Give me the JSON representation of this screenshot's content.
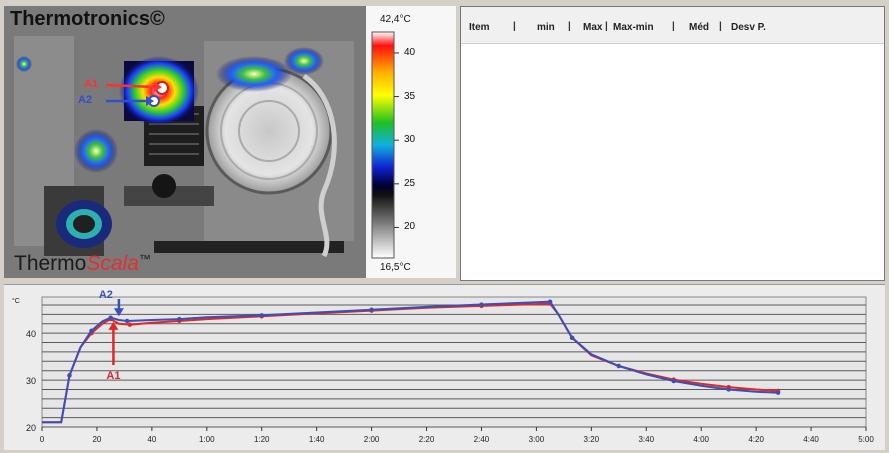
{
  "thermal_image": {
    "brand_top": "Thermotronics©",
    "brand_bottom_a": "Thermo",
    "brand_bottom_b": "Scala",
    "brand_bottom_c": "™",
    "point_a1": "A1",
    "point_a2": "A2"
  },
  "color_scale": {
    "max_label": "42,4°C",
    "min_label": "16,5°C",
    "ticks": [
      "40",
      "35",
      "30",
      "25",
      "20"
    ]
  },
  "table": {
    "columns": [
      "Item",
      "min",
      "Max",
      "Max-min",
      "Méd",
      "Desv P."
    ],
    "separator": "|"
  },
  "chart_data": {
    "type": "line",
    "ylabel": "°C",
    "ylim": [
      20,
      46
    ],
    "y_ticks": [
      "20",
      "30",
      "40"
    ],
    "x_ticks": [
      "0",
      "20",
      "40",
      "1:00",
      "1:20",
      "1:40",
      "2:00",
      "2:20",
      "2:40",
      "3:00",
      "3:20",
      "3:40",
      "4:00",
      "4:20",
      "4:40",
      "5:00"
    ],
    "xlim": [
      0,
      300
    ],
    "series": [
      {
        "name": "A2",
        "color": "#3a4fb8",
        "points": [
          [
            0,
            21
          ],
          [
            7,
            21
          ],
          [
            10,
            31
          ],
          [
            14,
            37
          ],
          [
            18,
            40.5
          ],
          [
            22,
            42.5
          ],
          [
            25,
            43.3
          ],
          [
            28,
            42.8
          ],
          [
            31,
            42.6
          ],
          [
            40,
            42.8
          ],
          [
            50,
            43
          ],
          [
            60,
            43.4
          ],
          [
            80,
            43.8
          ],
          [
            100,
            44.4
          ],
          [
            120,
            45
          ],
          [
            140,
            45.6
          ],
          [
            160,
            46.1
          ],
          [
            180,
            46.6
          ],
          [
            185,
            46.7
          ],
          [
            188,
            44
          ],
          [
            193,
            39
          ],
          [
            200,
            35.5
          ],
          [
            210,
            33
          ],
          [
            220,
            31.2
          ],
          [
            230,
            29.8
          ],
          [
            240,
            28.8
          ],
          [
            250,
            28
          ],
          [
            260,
            27.5
          ],
          [
            268,
            27.3
          ]
        ]
      },
      {
        "name": "A1",
        "color": "#e02828",
        "points": [
          [
            0,
            21
          ],
          [
            7,
            21
          ],
          [
            10,
            31
          ],
          [
            14,
            37
          ],
          [
            18,
            40
          ],
          [
            22,
            42
          ],
          [
            25,
            43
          ],
          [
            28,
            42
          ],
          [
            32,
            41.8
          ],
          [
            40,
            42.2
          ],
          [
            50,
            42.6
          ],
          [
            60,
            43
          ],
          [
            80,
            43.6
          ],
          [
            100,
            44.2
          ],
          [
            120,
            44.8
          ],
          [
            140,
            45.4
          ],
          [
            160,
            45.8
          ],
          [
            180,
            46.2
          ],
          [
            185,
            46.3
          ],
          [
            188,
            44
          ],
          [
            193,
            39
          ],
          [
            200,
            35.3
          ],
          [
            210,
            33
          ],
          [
            220,
            31.4
          ],
          [
            230,
            30.1
          ],
          [
            240,
            29.2
          ],
          [
            250,
            28.5
          ],
          [
            260,
            28
          ],
          [
            268,
            27.7
          ]
        ]
      }
    ],
    "annotations": [
      {
        "label": "A2",
        "x": 28,
        "color": "#3a4fb8"
      },
      {
        "label": "A1",
        "x": 26,
        "color": "#e02828"
      }
    ],
    "grid": true
  }
}
